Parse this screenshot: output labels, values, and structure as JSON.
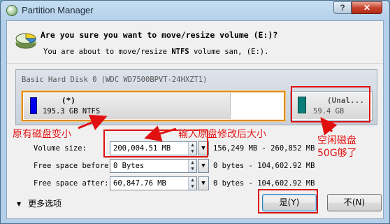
{
  "window": {
    "title": "Partition Manager",
    "help_label": "?",
    "close_label": "✕"
  },
  "header": {
    "question": "Are you sure you want to move/resize volume (E:)?",
    "sub_pre": "You are about to move/resize ",
    "sub_fs": "NTFS",
    "sub_post": " volume san,  (E:)."
  },
  "disk": {
    "label": "Basic Hard Disk 0 (WDC WD7500BPVT-24HXZT1)",
    "partition_main": {
      "name": "(*)",
      "size": "195.3 GB NTFS",
      "color": "#0000f0"
    },
    "partition_unallocated": {
      "name": "(Unal...",
      "size": "59.4 GB",
      "color": "#0a7f7a"
    }
  },
  "fields": {
    "volume_size": {
      "label": "Volume size:",
      "value": "200,004.51 MB",
      "range": "156,249 MB - 260,852 MB"
    },
    "free_before": {
      "label": "Free space before:",
      "value": "0 Bytes",
      "range": "0 bytes - 104,602.92 MB"
    },
    "free_after": {
      "label": "Free space after:",
      "value": "60,847.76 MB",
      "range": "0 bytes - 104,602.92 MB"
    }
  },
  "footer": {
    "more_options": "更多选项",
    "yes_label": "是(Y)",
    "no_label": "不(N)"
  },
  "annotations": {
    "shrink": "原有磁盘变小",
    "input_size": "输入原盘修改后大小",
    "free_line1": "空闲磁盘",
    "free_line2": "50G够了",
    "color": "#e01010"
  }
}
